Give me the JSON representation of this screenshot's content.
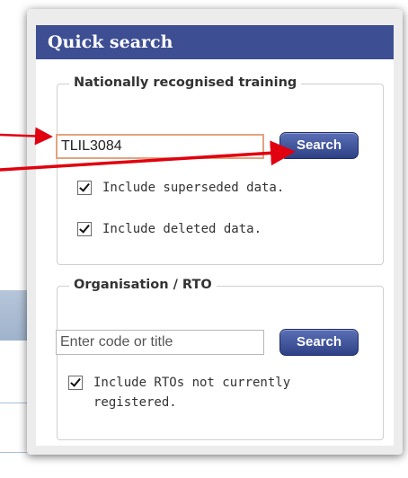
{
  "quick_search": {
    "title": "Quick search",
    "training": {
      "legend": "Nationally recognised training",
      "input_value": "TLIL3084",
      "search_label": "Search",
      "options": [
        {
          "label": "Include superseded data.",
          "checked": true
        },
        {
          "label": "Include deleted data.",
          "checked": true
        }
      ]
    },
    "rto": {
      "legend": "Organisation / RTO",
      "input_placeholder": "Enter code or title",
      "search_label": "Search",
      "options": [
        {
          "label_line1": "Include RTOs not currently",
          "label_line2": "registered.",
          "checked": true
        }
      ]
    }
  },
  "colors": {
    "header_bg": "#3d4e93",
    "button_bg": "#2f4185",
    "arrow": "#e0000f",
    "input_focus_border": "#e2a37f"
  }
}
